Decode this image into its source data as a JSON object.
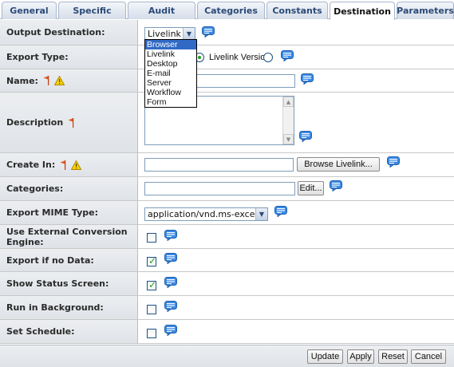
{
  "tabs": [
    "General",
    "Specific",
    "Audit",
    "Categories",
    "Constants",
    "Destination",
    "Parameters"
  ],
  "active_tab": "Destination",
  "rows": {
    "output_destination": {
      "label": "Output Destination:",
      "value": "Livelink"
    },
    "export_type": {
      "label": "Export Type:",
      "option_label": "Livelink Version"
    },
    "name": {
      "label": "Name:"
    },
    "description": {
      "label": "Description"
    },
    "create_in": {
      "label": "Create In:",
      "button": "Browse Livelink..."
    },
    "categories": {
      "label": "Categories:",
      "button": "Edit..."
    },
    "export_mime": {
      "label": "Export MIME Type:",
      "value": "application/vnd.ms-excel"
    },
    "use_external": {
      "label": "Use External Conversion Engine:",
      "checked": false
    },
    "export_no_data": {
      "label": "Export if no Data:",
      "checked": true
    },
    "show_status": {
      "label": "Show Status Screen:",
      "checked": true
    },
    "run_background": {
      "label": "Run in Background:",
      "checked": false
    },
    "set_schedule": {
      "label": "Set Schedule:",
      "checked": false
    }
  },
  "destination_options": [
    "Browser",
    "Livelink",
    "Desktop",
    "E-mail",
    "Server",
    "Workflow",
    "Form"
  ],
  "highlighted_option": "Browser",
  "footer_buttons": {
    "update": "Update",
    "apply": "Apply",
    "reset": "Reset",
    "cancel": "Cancel"
  },
  "colors": {
    "accent": "#2b4a78",
    "check": "#21a121",
    "flag": "#e05a1a",
    "warning": "#f2c200",
    "bubble": "#2f7fd9",
    "selection": "#316ac5"
  }
}
